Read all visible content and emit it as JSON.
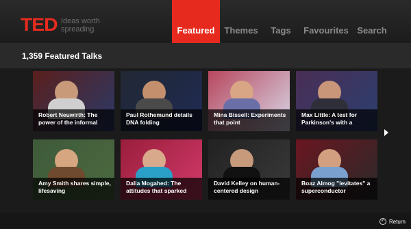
{
  "header": {
    "logo": "TED",
    "tagline": "Ideas worth spreading",
    "nav": [
      {
        "label": "Featured",
        "active": true
      },
      {
        "label": "Themes",
        "active": false
      },
      {
        "label": "Tags",
        "active": false
      },
      {
        "label": "Favourites",
        "active": false
      },
      {
        "label": "Search",
        "active": false
      }
    ]
  },
  "subheader": {
    "count_label": "1,359 Featured Talks"
  },
  "talks": [
    {
      "caption": "Robert Neuwirth: The power of the informal",
      "bg": "#5a1f1c",
      "accent": "#2a3a6a",
      "skin": "#c89a7a",
      "shirt": "#cfcfcf"
    },
    {
      "caption": "Paul Rothemund details DNA folding",
      "bg": "#222833",
      "accent": "#1e2a55",
      "skin": "#c48f6d",
      "shirt": "#4a4a4a"
    },
    {
      "caption": "Mina Bissell: Experiments that point",
      "bg": "#b7475e",
      "accent": "#d8d8e8",
      "skin": "#d8a585",
      "shirt": "#6b6fa8"
    },
    {
      "caption": "Max Little: A test for Parkinson's with a",
      "bg": "#4a2e55",
      "accent": "#2a3f70",
      "skin": "#c9967a",
      "shirt": "#2f2f3a"
    },
    {
      "caption": "Amy Smith shares simple, lifesaving",
      "bg": "#3e5a3a",
      "accent": "#4c6a40",
      "skin": "#d6a681",
      "shirt": "#6f4a2e"
    },
    {
      "caption": "Dalia Mogahed: The attitudes that sparked",
      "bg": "#9a1e3c",
      "accent": "#d23a6a",
      "skin": "#d8a98a",
      "shirt": "#2aa0c8"
    },
    {
      "caption": "David Kelley on human-centered design",
      "bg": "#222222",
      "accent": "#3a3a3a",
      "skin": "#c89a7c",
      "shirt": "#111111"
    },
    {
      "caption": "Boaz Almog \"levitates\" a superconductor",
      "bg": "#6a1620",
      "accent": "#2a2a2a",
      "skin": "#d2a080",
      "shirt": "#7aa0d0"
    }
  ],
  "next_arrow": "next-arrow",
  "footer": {
    "return_label": "Return",
    "return_icon": "back-icon"
  }
}
